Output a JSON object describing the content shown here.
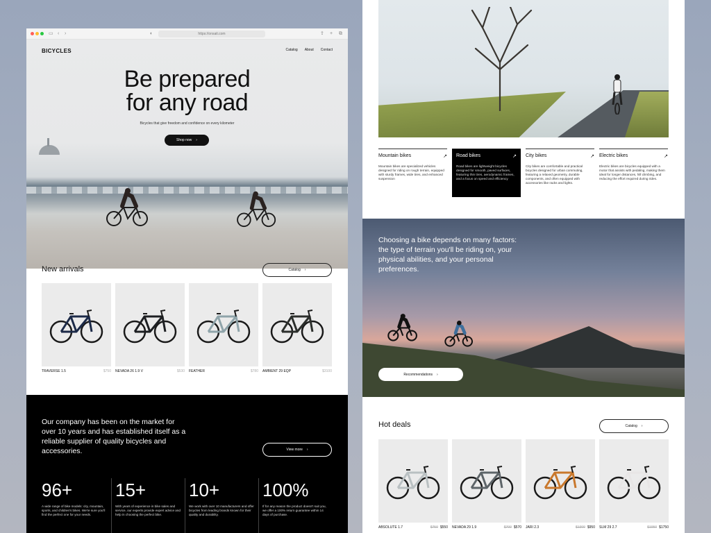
{
  "browser": {
    "url": "https://onsait.com"
  },
  "site": {
    "brand": "BICYCLES",
    "nav": [
      "Catalog",
      "About",
      "Contact"
    ]
  },
  "hero": {
    "title_line1": "Be prepared",
    "title_line2": "for any road",
    "subtitle": "Bicycles that give freedom and confidence on every kilometer",
    "cta": "Shop now"
  },
  "new_arrivals": {
    "title": "New arrivals",
    "button": "Catalog",
    "products": [
      {
        "name": "TRAVERSE 1.5",
        "price": "$750",
        "frame": "#1c2a48"
      },
      {
        "name": "NEVADA 26 1.9 V",
        "price": "$530",
        "frame": "#1d1f22"
      },
      {
        "name": "FEATHER",
        "price": "$780",
        "frame": "#8fa4aa"
      },
      {
        "name": "AMBIENT 29 EQP",
        "price": "$3100",
        "frame": "#2c2f2c"
      }
    ]
  },
  "company": {
    "text": "Our company has been on the market for over 10 years and has established itself as a reliable supplier of quality bicycles and accessories.",
    "button": "View more",
    "stats": [
      {
        "num": "96+",
        "desc": "A wide range of bike models: city, mountain, sports, and children's bikes. We're sure you'll find the perfect one for your needs."
      },
      {
        "num": "15+",
        "desc": "With years of experience in bike sales and service, our experts provide expert advice and help in choosing the perfect bike."
      },
      {
        "num": "10+",
        "desc": "We work with over 10 manufacturers and offer bicycles from leading brands known for their quality and durability."
      },
      {
        "num": "100%",
        "desc": "If for any reason the product doesn't suit you, we offer a 100% return guarantee within 14 days of purchase."
      }
    ]
  },
  "categories": [
    {
      "title": "Mountain bikes",
      "desc": "Mountain bikes are specialized vehicles designed for riding on rough terrain, equipped with sturdy frames, wide tires, and enhanced suspension"
    },
    {
      "title": "Road bikes",
      "desc": "Road bikes are lightweight bicycles designed for smooth, paved surfaces, featuring thin tires, aerodynamic frames, and a focus on speed and efficiency"
    },
    {
      "title": "City bikes",
      "desc": "City bikes are comfortable and practical bicycles designed for urban commuting, featuring a relaxed geometry, durable components, and often equipped with accessories like racks and lights."
    },
    {
      "title": "Electric bikes",
      "desc": "Electric bikes are bicycles equipped with a motor that assists with pedaling, making them ideal for longer distances, hill climbing, and reducing the effort required during rides."
    }
  ],
  "banner": {
    "text": "Choosing a bike depends on many factors: the type of terrain you'll be riding on, your physical abilities, and your personal preferences.",
    "button": "Recommendations"
  },
  "hot_deals": {
    "title": "Hot deals",
    "button": "Catalog",
    "products": [
      {
        "name": "ABSOLUTE 1.7",
        "old": "$750",
        "price": "$550",
        "frame": "#b9c0c2"
      },
      {
        "name": "NEVADA 29 1.9",
        "old": "$700",
        "price": "$570",
        "frame": "#5d6468"
      },
      {
        "name": "JARI 2.3",
        "old": "$1300",
        "price": "$950",
        "frame": "#c9782c"
      },
      {
        "name": "SLM 29 2.7",
        "old": "$1950",
        "price": "$1750",
        "frame": "#e8e6e6"
      }
    ]
  },
  "icons": {
    "arrow": "chevron-right-icon",
    "corner": "arrow-up-right-icon"
  }
}
